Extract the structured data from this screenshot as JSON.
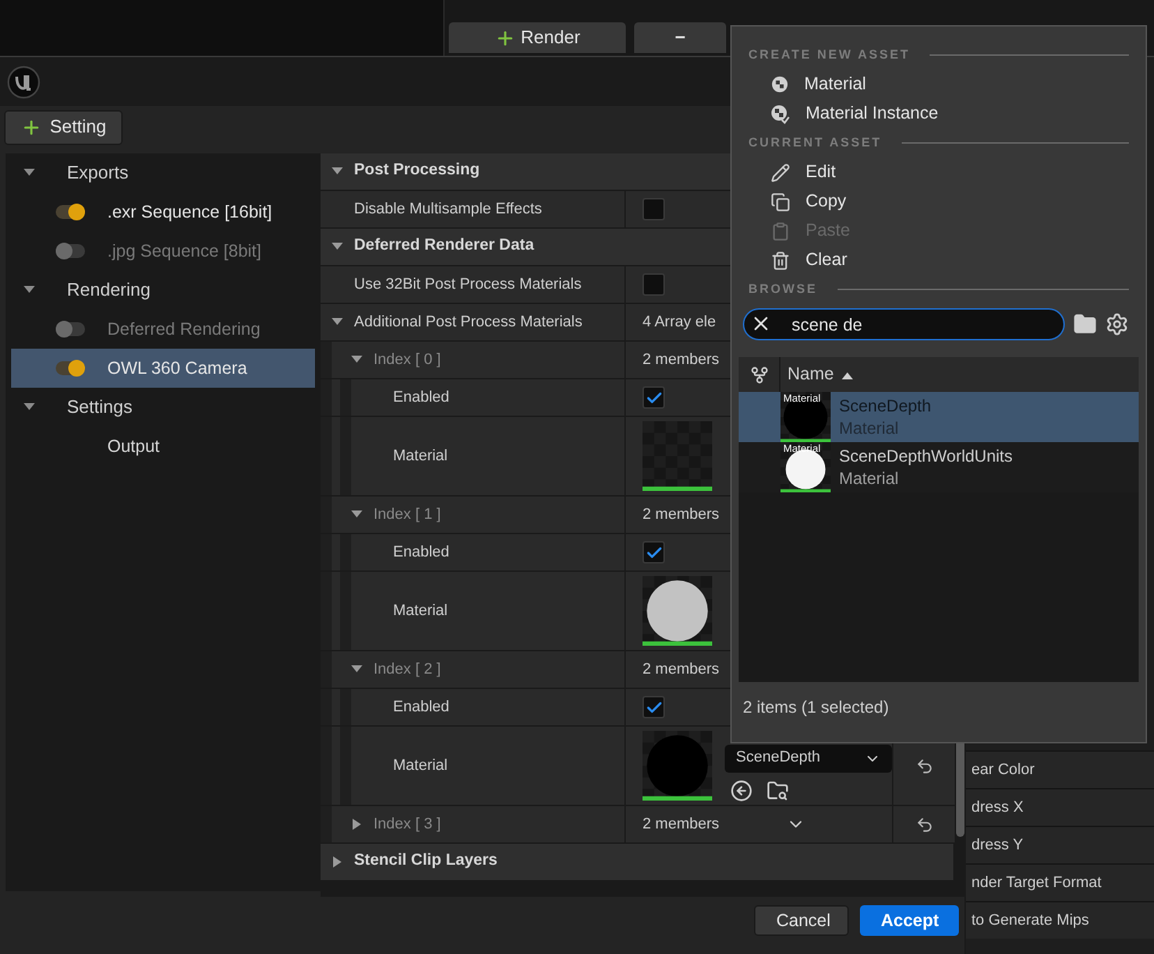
{
  "top_toolbar": {
    "buttons": [
      {
        "kind": "add",
        "label": "Render"
      },
      {
        "kind": "remove",
        "label": "−"
      }
    ]
  },
  "toolbar": {
    "add_button": "Setting"
  },
  "tree": [
    {
      "kind": "group",
      "label": "Exports",
      "expanded": true,
      "selected": false,
      "children": [
        {
          "kind": "toggle",
          "label": ".exr Sequence [16bit]",
          "on": true,
          "selected": false
        },
        {
          "kind": "toggle",
          "label": ".jpg Sequence [8bit]",
          "on": false,
          "selected": false
        }
      ]
    },
    {
      "kind": "group",
      "label": "Rendering",
      "expanded": true,
      "selected": false,
      "children": [
        {
          "kind": "toggle",
          "label": "Deferred Rendering",
          "on": false,
          "selected": false
        },
        {
          "kind": "toggle",
          "label": "OWL 360 Camera",
          "on": true,
          "selected": true
        }
      ]
    },
    {
      "kind": "group",
      "label": "Settings",
      "expanded": true,
      "selected": false,
      "children": [
        {
          "kind": "plain",
          "label": "Output",
          "selected": false
        }
      ]
    }
  ],
  "details": {
    "rows": [
      {
        "kind": "category",
        "label": "Post Processing",
        "expanded": true
      },
      {
        "kind": "checkbox",
        "label": "Disable Multisample Effects",
        "checked": false
      },
      {
        "kind": "category",
        "label": "Deferred Renderer Data",
        "expanded": true
      },
      {
        "kind": "checkbox",
        "label": "Use 32Bit Post Process Materials",
        "checked": false
      },
      {
        "kind": "array",
        "label": "Additional Post Process Materials",
        "value": "4 Array ele",
        "expanded": true,
        "children": [
          {
            "kind": "index",
            "label": "Index [ 0 ]",
            "value": "2 members",
            "expanded": true,
            "children": [
              {
                "kind": "checkbox",
                "label": "Enabled",
                "checked": true
              },
              {
                "kind": "material",
                "label": "Material",
                "thumbnail": {
                  "kind": "empty"
                }
              }
            ]
          },
          {
            "kind": "index",
            "label": "Index [ 1 ]",
            "value": "2 members",
            "expanded": true,
            "children": [
              {
                "kind": "checkbox",
                "label": "Enabled",
                "checked": true
              },
              {
                "kind": "material",
                "label": "Material",
                "thumbnail": {
                  "kind": "gray-sphere"
                }
              }
            ]
          },
          {
            "kind": "index",
            "label": "Index [ 2 ]",
            "value": "2 members",
            "expanded": true,
            "children": [
              {
                "kind": "checkbox",
                "label": "Enabled",
                "checked": true
              },
              {
                "kind": "material",
                "label": "Material",
                "thumbnail": {
                  "kind": "black-sphere"
                },
                "asset": "SceneDepth",
                "reset": true
              }
            ]
          },
          {
            "kind": "index",
            "label": "Index [ 3 ]",
            "value": "2 members",
            "expanded": false,
            "menu": true,
            "reset": true
          }
        ]
      },
      {
        "kind": "category",
        "label": "Stencil Clip Layers",
        "expanded": false
      }
    ]
  },
  "dialog_buttons": [
    {
      "label": "Cancel",
      "primary": false
    },
    {
      "label": "Accept",
      "primary": true
    }
  ],
  "background_rows": [
    "ear Color",
    "dress X",
    "dress Y",
    "nder Target Format",
    "to Generate Mips"
  ],
  "popup": {
    "sections": [
      {
        "heading": "CREATE NEW ASSET",
        "items": [
          {
            "kind": "material",
            "label": "Material",
            "disabled": false
          },
          {
            "kind": "instance",
            "label": "Material Instance",
            "disabled": false
          }
        ]
      },
      {
        "heading": "CURRENT ASSET",
        "items": [
          {
            "kind": "edit",
            "label": "Edit",
            "disabled": false
          },
          {
            "kind": "copy",
            "label": "Copy",
            "disabled": false
          },
          {
            "kind": "paste",
            "label": "Paste",
            "disabled": true
          },
          {
            "kind": "clear",
            "label": "Clear",
            "disabled": false
          }
        ]
      }
    ],
    "browse_heading": "BROWSE",
    "search": {
      "value": "scene de"
    },
    "column": "Name",
    "assets": [
      {
        "name": "SceneDepth",
        "type": "Material",
        "thumb_label": "Material",
        "thumbnail": {
          "kind": "black-sphere"
        },
        "selected": true
      },
      {
        "name": "SceneDepthWorldUnits",
        "type": "Material",
        "thumb_label": "Material",
        "thumbnail": {
          "kind": "white-sphere"
        },
        "selected": false
      }
    ],
    "status": "2 items (1 selected)"
  }
}
